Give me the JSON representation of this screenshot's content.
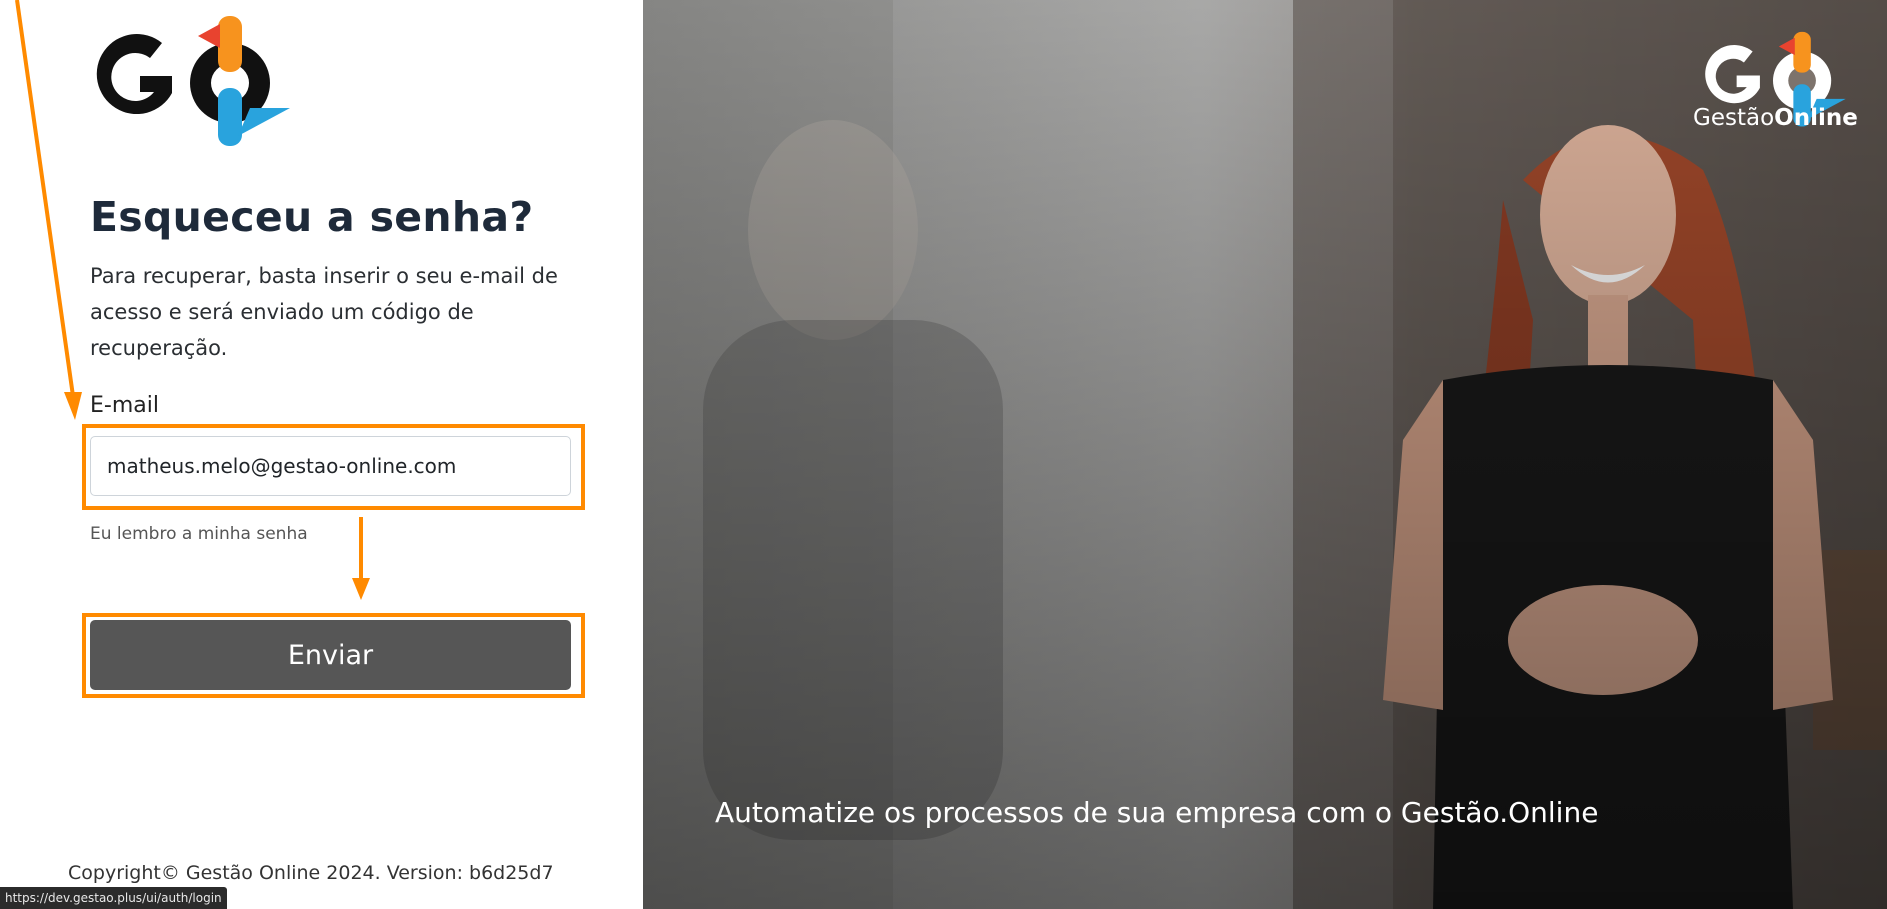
{
  "auth": {
    "title": "Esqueceu a senha?",
    "subtitle": "Para recuperar, basta inserir o seu e-mail de acesso e será enviado um código de recuperação.",
    "email_label": "E-mail",
    "email_value": "matheus.melo@gestao-online.com",
    "remember_link": "Eu lembro a minha senha",
    "submit_label": "Enviar",
    "copyright": "Copyright© Gestão Online 2024. Version: b6d25d7"
  },
  "status_bar": {
    "url": "https://dev.gestao.plus/ui/auth/login"
  },
  "hero": {
    "tagline": "Automatize os processos de sua empresa com o Gestão.Online",
    "brand_prefix": "Gestão",
    "brand_suffix": "Online"
  },
  "logos": {
    "left": "go-logo",
    "right": "go-logo-white"
  },
  "colors": {
    "highlight": "#ff8a00",
    "button": "#565656",
    "logo_orange": "#f7931e",
    "logo_blue": "#29a3dd",
    "logo_red": "#e8432f",
    "title": "#1e2a3a"
  }
}
